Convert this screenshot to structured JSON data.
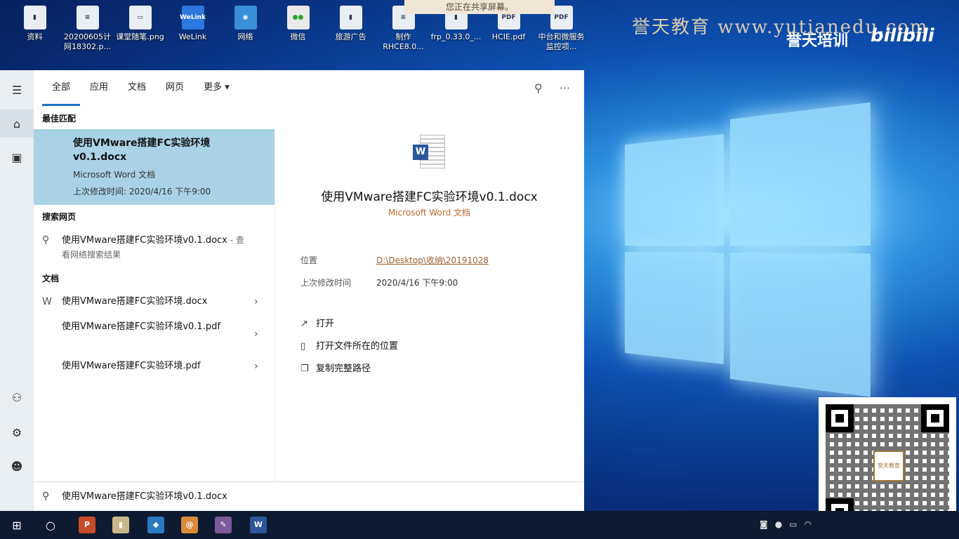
{
  "banner": {
    "text": "您正在共享屏幕。"
  },
  "watermark": {
    "main": "誉天教育  www.yutianedu.com",
    "sub": "誉天培训",
    "logo": "bilibili"
  },
  "desktop_icons": [
    {
      "label": "资料",
      "icon": "folder-zip-icon"
    },
    {
      "label": "20200605计网18302.p...",
      "icon": "document-icon"
    },
    {
      "label": "课堂随笔.png",
      "icon": "image-icon"
    },
    {
      "label": "WeLink",
      "icon": "welink-icon",
      "badge": "WeLink"
    },
    {
      "label": "网络",
      "icon": "network-icon"
    },
    {
      "label": "微信",
      "icon": "wechat-icon"
    },
    {
      "label": "旅游广告",
      "icon": "archive-icon"
    },
    {
      "label": "制作RHCE8.0...",
      "icon": "document-icon"
    },
    {
      "label": "frp_0.33.0_...",
      "icon": "archive-icon"
    },
    {
      "label": "HCIE.pdf",
      "icon": "pdf-icon",
      "badge": "PDF"
    },
    {
      "label": "中台和微服务监控项...",
      "icon": "pdf-icon",
      "badge": "PDF"
    }
  ],
  "search": {
    "tabs": [
      {
        "label": "全部",
        "active": true
      },
      {
        "label": "应用"
      },
      {
        "label": "文档"
      },
      {
        "label": "网页"
      },
      {
        "label": "更多 ▾"
      }
    ],
    "sections": {
      "best_match": "最佳匹配",
      "web": "搜索网页",
      "documents": "文档"
    },
    "best_match": {
      "title": "使用VMware搭建FC实验环境v0.1.docx",
      "type": "Microsoft Word 文档",
      "modified": "上次修改时间: 2020/4/16 下午9:00"
    },
    "web_result": {
      "text": "使用VMware搭建FC实验环境v0.1.docx",
      "hint": " - 查看网络搜索结果"
    },
    "documents": [
      {
        "name": "使用VMware搭建FC实验环境.docx"
      },
      {
        "name": "使用VMware搭建FC实验环境v0.1.pdf"
      },
      {
        "name": "使用VMware搭建FC实验环境.pdf"
      }
    ],
    "query": "使用VMware搭建FC实验环境v0.1.docx"
  },
  "detail": {
    "title": "使用VMware搭建FC实验环境v0.1.docx",
    "type": "Microsoft Word 文档",
    "location_label": "位置",
    "location_value": "D:\\Desktop\\收纳\\20191028",
    "modified_label": "上次修改时间",
    "modified_value": "2020/4/16 下午9:00",
    "actions": [
      {
        "label": "打开",
        "icon": "open-icon"
      },
      {
        "label": "打开文件所在的位置",
        "icon": "folder-location-icon"
      },
      {
        "label": "复制完整路径",
        "icon": "copy-path-icon"
      }
    ]
  },
  "qr": {
    "center_text": "誉天教育"
  },
  "colors": {
    "accent": "#1f6fc9",
    "best_match_bg": "#a9d2e6",
    "link": "#a06030",
    "taskbar": "#0e1a30"
  }
}
